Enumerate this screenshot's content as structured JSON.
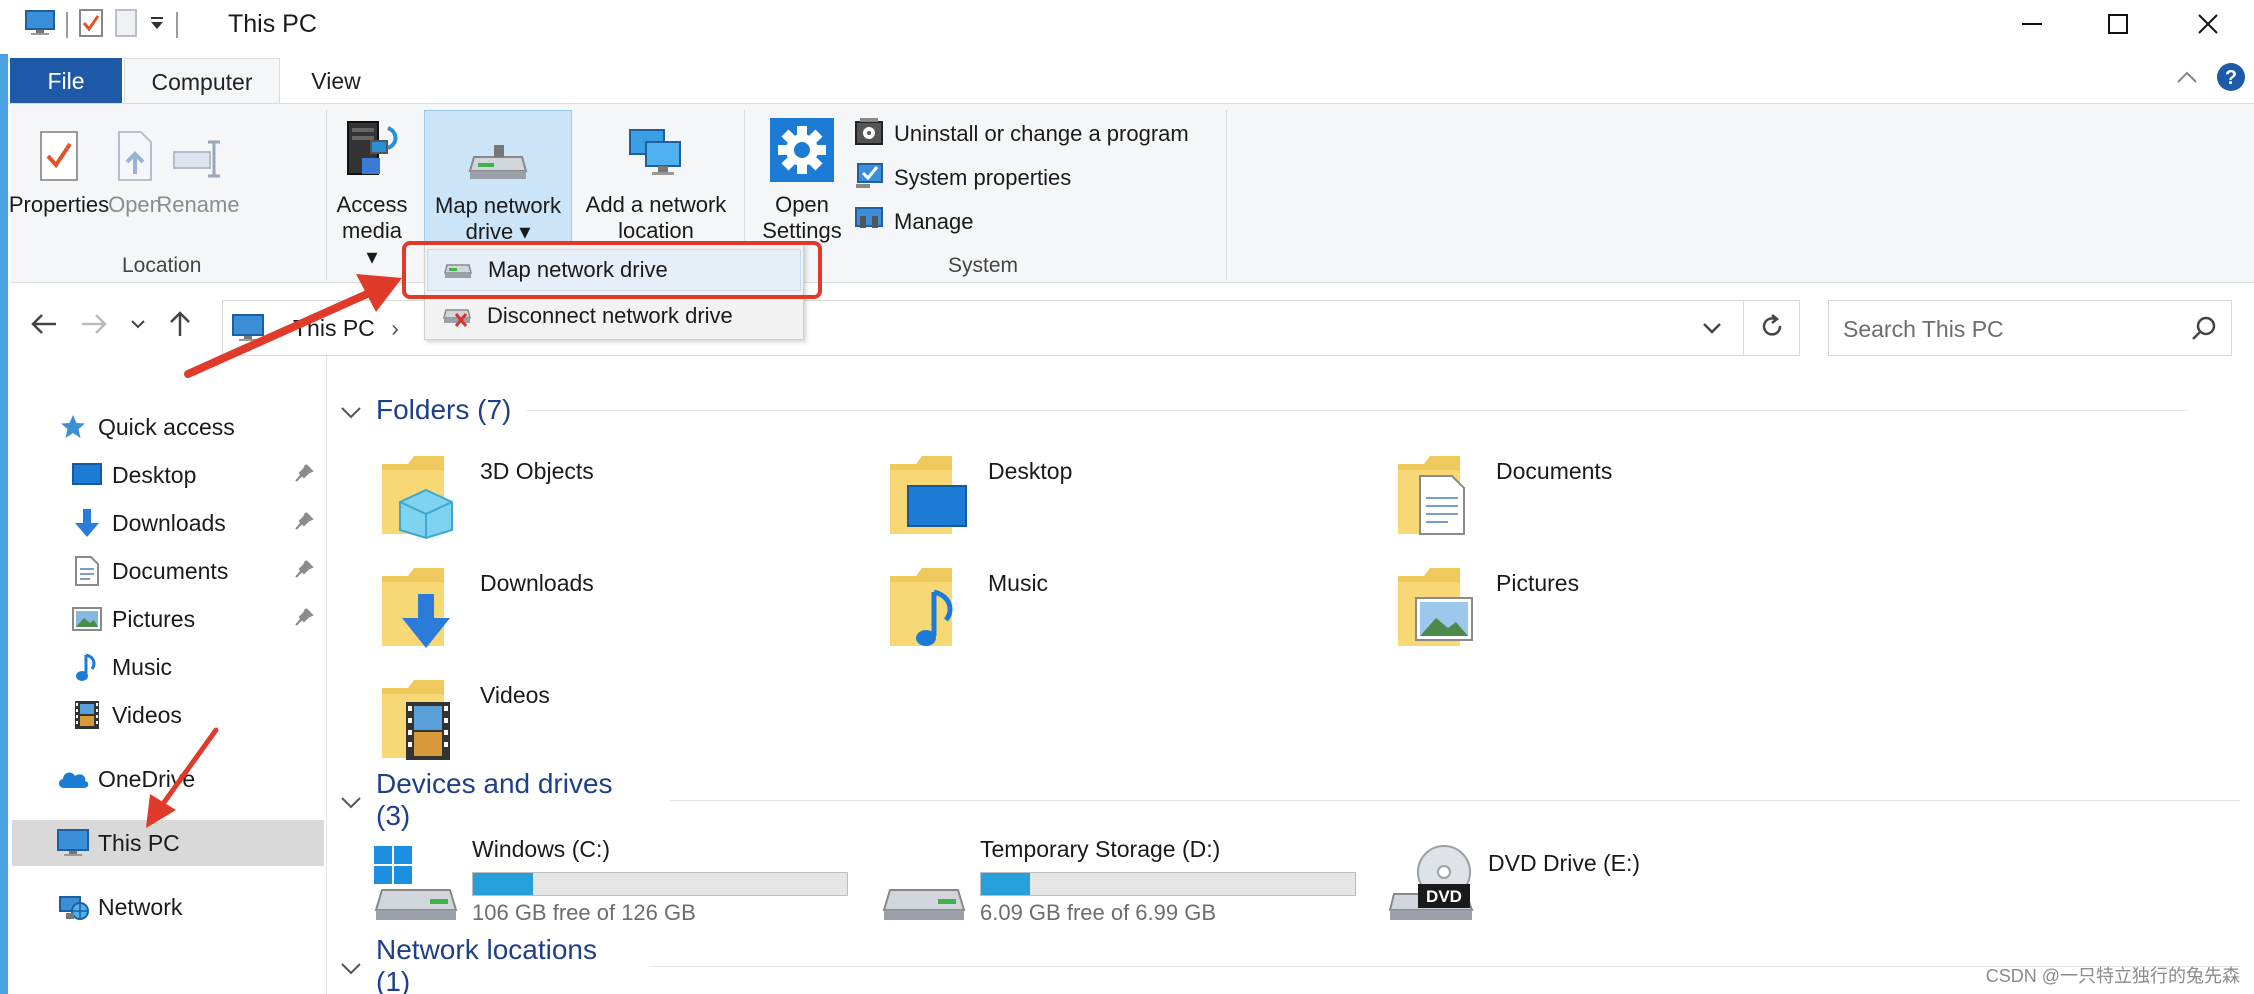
{
  "window": {
    "title": "This PC",
    "controls": {
      "minimize": "minimize",
      "maximize": "maximize",
      "close": "close"
    }
  },
  "ribbon_tabs": [
    {
      "label": "File",
      "active": false
    },
    {
      "label": "Computer",
      "active": true
    },
    {
      "label": "View",
      "active": false
    }
  ],
  "ribbon": {
    "location_group": {
      "label": "Location",
      "buttons": {
        "properties": "Properties",
        "open": "Open",
        "rename": "Rename"
      }
    },
    "network_group": {
      "access_media": {
        "line1": "Access",
        "line2": "media ▾"
      },
      "map_network_drive": {
        "line1": "Map network",
        "line2": "drive ▾"
      },
      "add_network_location": {
        "line1": "Add a network",
        "line2": "location"
      }
    },
    "system_group": {
      "label": "System",
      "open_settings": {
        "line1": "Open",
        "line2": "Settings"
      },
      "items": {
        "uninstall": "Uninstall or change a program",
        "system_properties": "System properties",
        "manage": "Manage"
      }
    }
  },
  "dropdown_menu": {
    "map": "Map network drive",
    "disconnect": "Disconnect network drive"
  },
  "address": {
    "path": "This PC",
    "separator": "›"
  },
  "search": {
    "placeholder": "Search This PC"
  },
  "sidebar": {
    "quick_access": "Quick access",
    "items": {
      "desktop": "Desktop",
      "downloads": "Downloads",
      "documents": "Documents",
      "pictures": "Pictures",
      "music": "Music",
      "videos": "Videos"
    },
    "onedrive": "OneDrive",
    "this_pc": "This PC",
    "network": "Network"
  },
  "content": {
    "folders_header": "Folders (7)",
    "folders": {
      "objects3d": "3D Objects",
      "desktop": "Desktop",
      "documents": "Documents",
      "downloads": "Downloads",
      "music": "Music",
      "pictures": "Pictures",
      "videos": "Videos"
    },
    "devices_header": "Devices and drives (3)",
    "drives": {
      "c": {
        "name": "Windows (C:)",
        "free": "106 GB free of 126 GB",
        "used_fraction": 0.16
      },
      "d": {
        "name": "Temporary Storage (D:)",
        "free": "6.09 GB free of 6.99 GB",
        "used_fraction": 0.13
      },
      "e": {
        "name": "DVD Drive (E:)",
        "badge": "DVD"
      }
    },
    "network_header": "Network locations (1)"
  },
  "watermark": "CSDN @一只特立独行的兔先森",
  "colors": {
    "accent": "#1e5aa8",
    "header_text": "#1e3f8a",
    "annotation": "#e03a2a",
    "drive_bar": "#26a0da"
  }
}
